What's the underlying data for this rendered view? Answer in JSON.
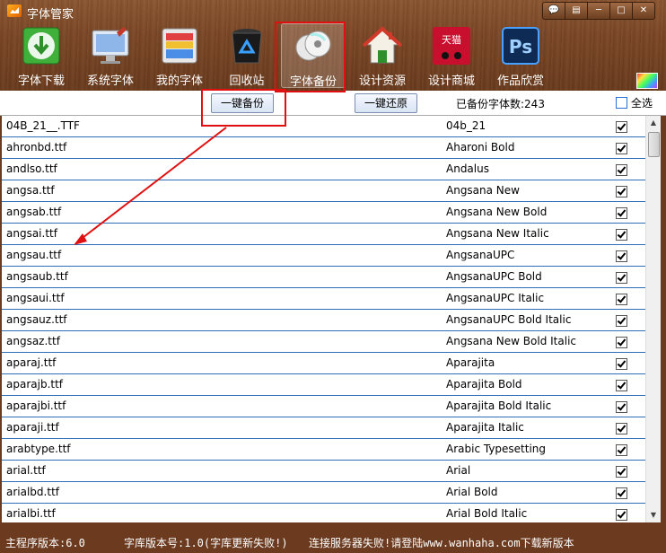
{
  "window": {
    "title": "字体管家"
  },
  "toolbar": {
    "tools": [
      {
        "label": "字体下载"
      },
      {
        "label": "系统字体"
      },
      {
        "label": "我的字体"
      },
      {
        "label": "回收站"
      },
      {
        "label": "字体备份"
      },
      {
        "label": "设计资源"
      },
      {
        "label": "设计商城"
      },
      {
        "label": "作品欣赏"
      }
    ],
    "active_index": 4,
    "mall_icon_text": "天猫"
  },
  "actions": {
    "backup_label": "一键备份",
    "restore_label": "一键还原",
    "count_text": "已备份字体数:243",
    "select_all_label": "全选"
  },
  "rows": [
    {
      "file": "04B_21__.TTF",
      "font": "04b_21"
    },
    {
      "file": "ahronbd.ttf",
      "font": "Aharoni Bold"
    },
    {
      "file": "andlso.ttf",
      "font": "Andalus"
    },
    {
      "file": "angsa.ttf",
      "font": "Angsana New"
    },
    {
      "file": "angsab.ttf",
      "font": "Angsana New Bold"
    },
    {
      "file": "angsai.ttf",
      "font": "Angsana New Italic"
    },
    {
      "file": "angsau.ttf",
      "font": "AngsanaUPC"
    },
    {
      "file": "angsaub.ttf",
      "font": "AngsanaUPC Bold"
    },
    {
      "file": "angsaui.ttf",
      "font": "AngsanaUPC Italic"
    },
    {
      "file": "angsauz.ttf",
      "font": "AngsanaUPC Bold Italic"
    },
    {
      "file": "angsaz.ttf",
      "font": "Angsana New Bold Italic"
    },
    {
      "file": "aparaj.ttf",
      "font": "Aparajita"
    },
    {
      "file": "aparajb.ttf",
      "font": "Aparajita Bold"
    },
    {
      "file": "aparajbi.ttf",
      "font": "Aparajita Bold Italic"
    },
    {
      "file": "aparaji.ttf",
      "font": "Aparajita Italic"
    },
    {
      "file": "arabtype.ttf",
      "font": "Arabic Typesetting"
    },
    {
      "file": "arial.ttf",
      "font": "Arial"
    },
    {
      "file": "arialbd.ttf",
      "font": "Arial Bold"
    },
    {
      "file": "arialbi.ttf",
      "font": "Arial Bold Italic"
    }
  ],
  "status": {
    "program_version": "主程序版本:6.0",
    "library_version": "字库版本号:1.0(字库更新失败!)",
    "connection": "连接服务器失败!请登陆www.wanhaha.com下载新版本"
  },
  "colors": {
    "annotation": "#e01010",
    "row_divider": "#2f6fb6",
    "wood": "#7a4624"
  }
}
